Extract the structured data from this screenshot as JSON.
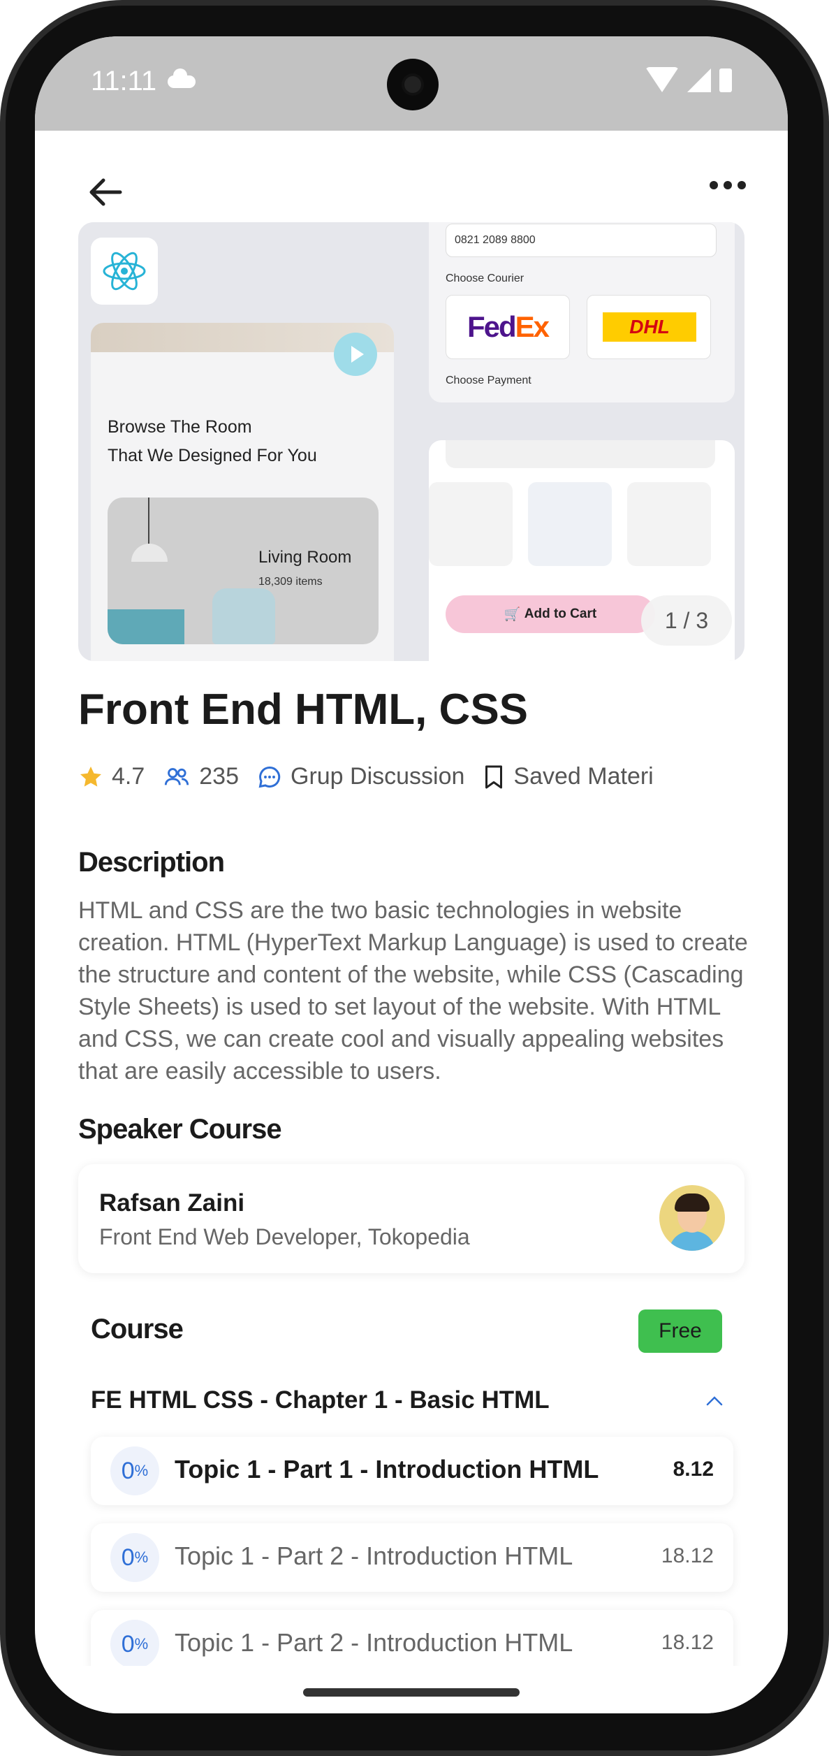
{
  "status_bar": {
    "time": "11:11",
    "icons": [
      "cloud-icon",
      "wifi-icon",
      "cell-signal-icon",
      "battery-icon"
    ]
  },
  "header": {
    "back_icon": "arrow-left-icon",
    "more_icon": "more-horizontal-icon"
  },
  "hero": {
    "pager": "1 / 3",
    "mock_left": {
      "headline_1": "Browse The Room",
      "headline_2": "That We Designed For You",
      "room_name": "Living Room",
      "room_items": "18,309 items"
    },
    "mock_right": {
      "phone": "0821 2089 8800",
      "choose_courier": "Choose Courier",
      "choose_payment": "Choose Payment",
      "courier_1": "FedEx",
      "courier_2": "DHL",
      "add_to_cart": "Add to Cart"
    }
  },
  "course": {
    "title": "Front End HTML, CSS",
    "rating": "4.7",
    "participants": "235",
    "discussion": "Grup Discussion",
    "saved": "Saved Materi"
  },
  "description": {
    "heading": "Description",
    "text": "HTML and CSS are the two basic technologies in website creation. HTML (HyperText Markup Language) is used to create the structure and content of the website, while CSS (Cascading Style Sheets) is used to set layout of the website. With HTML and CSS, we can create cool and visually appealing websites that are easily accessible to users."
  },
  "speaker": {
    "heading": "Speaker Course",
    "name": "Rafsan Zaini",
    "role": "Front End Web Developer, Tokopedia"
  },
  "syllabus": {
    "heading": "Course",
    "badge": "Free",
    "chapter": "FE HTML CSS - Chapter 1 - Basic HTML",
    "topics": [
      {
        "progress": "0",
        "unit": "%",
        "title": "Topic 1 - Part 1 - Introduction HTML",
        "duration": "8.12"
      },
      {
        "progress": "0",
        "unit": "%",
        "title": "Topic 1 - Part 2 - Introduction HTML",
        "duration": "18.12"
      },
      {
        "progress": "0",
        "unit": "%",
        "title": "Topic 1 - Part 2 - Introduction HTML",
        "duration": "18.12"
      }
    ]
  },
  "colors": {
    "accent": "#2f6fd6",
    "free_badge": "#3fbf4f",
    "star": "#f5b82e"
  }
}
